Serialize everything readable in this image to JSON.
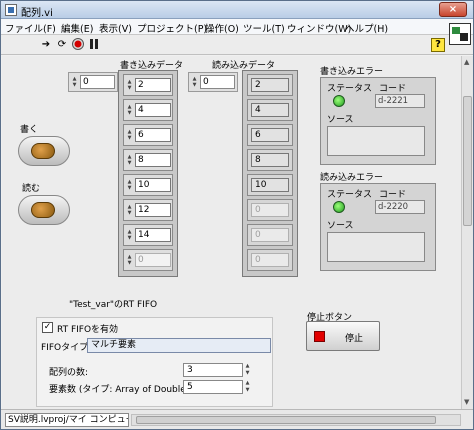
{
  "window": {
    "title": "配列.vi",
    "close_label": "×"
  },
  "menu": [
    "ファイル(F)",
    "編集(E)",
    "表示(V)",
    "プロジェクト(P)",
    "操作(O)",
    "ツール(T)",
    "ウィンドウ(W)",
    "ヘルプ(H)"
  ],
  "toolbar": {
    "run_icon": "run-arrow",
    "run_continuous_icon": "run-continuous",
    "abort_icon": "abort",
    "pause_icon": "pause",
    "help_label": "?"
  },
  "write_data": {
    "label": "書き込みデータ",
    "index": "0",
    "values": [
      "2",
      "4",
      "6",
      "8",
      "10",
      "12",
      "14",
      "0"
    ]
  },
  "read_data": {
    "label": "読み込みデータ",
    "index": "0",
    "values": [
      "2",
      "4",
      "6",
      "8",
      "10",
      "0",
      "0",
      "0"
    ]
  },
  "buttons": {
    "write_label": "書く",
    "read_label": "読む"
  },
  "write_error": {
    "label": "書き込みエラー",
    "status_label": "ステータス",
    "code_label": "コード",
    "code_value": "d-2221",
    "source_label": "ソース"
  },
  "read_error": {
    "label": "読み込みエラー",
    "status_label": "ステータス",
    "code_label": "コード",
    "code_value": "d-2220",
    "source_label": "ソース"
  },
  "fifo": {
    "caption": "\"Test_var\"のRT FIFO",
    "enable_label": "RT FIFOを有効",
    "enable_mark": "✓",
    "type_label": "FIFOタイプ:",
    "type_value": "マルチ要素",
    "arrays_label": "配列の数:",
    "arrays_value": "3",
    "elements_label": "要素数 (タイプ: Array of Double):",
    "elements_value": "5"
  },
  "stop": {
    "label": "停止ボタン",
    "button_text": "停止"
  },
  "status": {
    "context": "SV説明.lvproj/マイ コンピュータ"
  },
  "colors": {
    "led_on": "#2fc02f",
    "stop_red": "#e20000",
    "lamp_orange": "#c8841e"
  }
}
